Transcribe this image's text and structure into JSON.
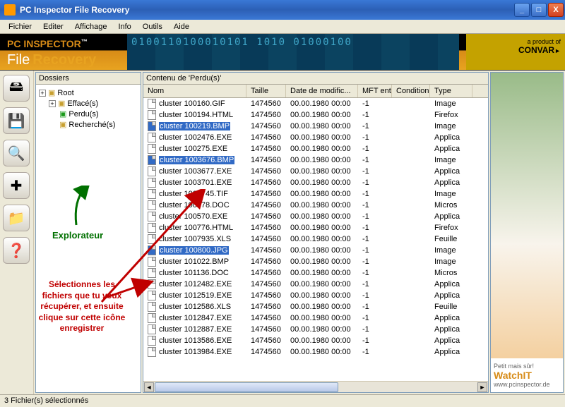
{
  "window": {
    "title": "PC Inspector File Recovery"
  },
  "menu": {
    "items": [
      "Fichier",
      "Editer",
      "Affichage",
      "Info",
      "Outils",
      "Aide"
    ]
  },
  "banner": {
    "pc": "PC",
    "inspector": "INSPECTOR",
    "tm": "™",
    "file": "File",
    "recovery": "Recovery",
    "product_of": "a product of",
    "convar": "CONVAR"
  },
  "toolbar": {
    "buttons": [
      {
        "name": "open-drive-button",
        "glyph": "🖴"
      },
      {
        "name": "save-button",
        "glyph": "💾"
      },
      {
        "name": "search-button",
        "glyph": "🔍"
      },
      {
        "name": "recover-button",
        "glyph": "✚"
      },
      {
        "name": "folder-button",
        "glyph": "📁"
      },
      {
        "name": "help-button",
        "glyph": "❓"
      }
    ]
  },
  "tree": {
    "header": "Dossiers",
    "nodes": [
      {
        "label": "Root",
        "exp": "+",
        "cls": ""
      },
      {
        "label": "Effacé(s)",
        "exp": "+",
        "cls": ""
      },
      {
        "label": "Perdu(s)",
        "exp": "",
        "cls": "green"
      },
      {
        "label": "Recherché(s)",
        "exp": "",
        "cls": ""
      }
    ]
  },
  "content": {
    "header": "Contenu de 'Perdu(s)'",
    "columns": [
      "Nom",
      "Taille",
      "Date de modific...",
      "MFT entry",
      "Condition",
      "Type"
    ],
    "rows": [
      {
        "n": "cluster 100160.GIF",
        "t": "1474560",
        "d": "00.00.1980 00:00",
        "m": "-1",
        "c": "",
        "ty": "Image",
        "sel": false
      },
      {
        "n": "cluster 100194.HTML",
        "t": "1474560",
        "d": "00.00.1980 00:00",
        "m": "-1",
        "c": "",
        "ty": "Firefox",
        "sel": false
      },
      {
        "n": "cluster 100219.BMP",
        "t": "1474560",
        "d": "00.00.1980 00:00",
        "m": "-1",
        "c": "",
        "ty": "Image",
        "sel": true
      },
      {
        "n": "cluster 1002476.EXE",
        "t": "1474560",
        "d": "00.00.1980 00:00",
        "m": "-1",
        "c": "",
        "ty": "Applica",
        "sel": false
      },
      {
        "n": "cluster 100275.EXE",
        "t": "1474560",
        "d": "00.00.1980 00:00",
        "m": "-1",
        "c": "",
        "ty": "Applica",
        "sel": false
      },
      {
        "n": "cluster 1003676.BMP",
        "t": "1474560",
        "d": "00.00.1980 00:00",
        "m": "-1",
        "c": "",
        "ty": "Image",
        "sel": true
      },
      {
        "n": "cluster 1003677.EXE",
        "t": "1474560",
        "d": "00.00.1980 00:00",
        "m": "-1",
        "c": "",
        "ty": "Applica",
        "sel": false
      },
      {
        "n": "cluster 1003701.EXE",
        "t": "1474560",
        "d": "00.00.1980 00:00",
        "m": "-1",
        "c": "",
        "ty": "Applica",
        "sel": false
      },
      {
        "n": "cluster 1003745.TIF",
        "t": "1474560",
        "d": "00.00.1980 00:00",
        "m": "-1",
        "c": "",
        "ty": "Image",
        "sel": false
      },
      {
        "n": "cluster 100378.DOC",
        "t": "1474560",
        "d": "00.00.1980 00:00",
        "m": "-1",
        "c": "",
        "ty": "Micros",
        "sel": false
      },
      {
        "n": "cluster 100570.EXE",
        "t": "1474560",
        "d": "00.00.1980 00:00",
        "m": "-1",
        "c": "",
        "ty": "Applica",
        "sel": false
      },
      {
        "n": "cluster 100776.HTML",
        "t": "1474560",
        "d": "00.00.1980 00:00",
        "m": "-1",
        "c": "",
        "ty": "Firefox",
        "sel": false
      },
      {
        "n": "cluster 1007935.XLS",
        "t": "1474560",
        "d": "00.00.1980 00:00",
        "m": "-1",
        "c": "",
        "ty": "Feuille",
        "sel": false
      },
      {
        "n": "cluster 100800.JPG",
        "t": "1474560",
        "d": "00.00.1980 00:00",
        "m": "-1",
        "c": "",
        "ty": "Image",
        "sel": true
      },
      {
        "n": "cluster 101022.BMP",
        "t": "1474560",
        "d": "00.00.1980 00:00",
        "m": "-1",
        "c": "",
        "ty": "Image",
        "sel": false
      },
      {
        "n": "cluster 101136.DOC",
        "t": "1474560",
        "d": "00.00.1980 00:00",
        "m": "-1",
        "c": "",
        "ty": "Micros",
        "sel": false
      },
      {
        "n": "cluster 1012482.EXE",
        "t": "1474560",
        "d": "00.00.1980 00:00",
        "m": "-1",
        "c": "",
        "ty": "Applica",
        "sel": false
      },
      {
        "n": "cluster 1012519.EXE",
        "t": "1474560",
        "d": "00.00.1980 00:00",
        "m": "-1",
        "c": "",
        "ty": "Applica",
        "sel": false
      },
      {
        "n": "cluster 1012586.XLS",
        "t": "1474560",
        "d": "00.00.1980 00:00",
        "m": "-1",
        "c": "",
        "ty": "Feuille",
        "sel": false
      },
      {
        "n": "cluster 1012847.EXE",
        "t": "1474560",
        "d": "00.00.1980 00:00",
        "m": "-1",
        "c": "",
        "ty": "Applica",
        "sel": false
      },
      {
        "n": "cluster 1012887.EXE",
        "t": "1474560",
        "d": "00.00.1980 00:00",
        "m": "-1",
        "c": "",
        "ty": "Applica",
        "sel": false
      },
      {
        "n": "cluster 1013586.EXE",
        "t": "1474560",
        "d": "00.00.1980 00:00",
        "m": "-1",
        "c": "",
        "ty": "Applica",
        "sel": false
      },
      {
        "n": "cluster 1013984.EXE",
        "t": "1474560",
        "d": "00.00.1980 00:00",
        "m": "-1",
        "c": "",
        "ty": "Applica",
        "sel": false
      }
    ]
  },
  "ad": {
    "petit": "Petit mais sûr!",
    "watch": "Watch",
    "it": "IT",
    "url": "www.pcinspector.de"
  },
  "status": "3 Fichier(s) sélectionnés",
  "anno": {
    "explorateur": "Explorateur",
    "selection": "Sélectionnes les fichiers que tu veux récupérer, et ensuite clique sur cette icône enregistrer"
  }
}
